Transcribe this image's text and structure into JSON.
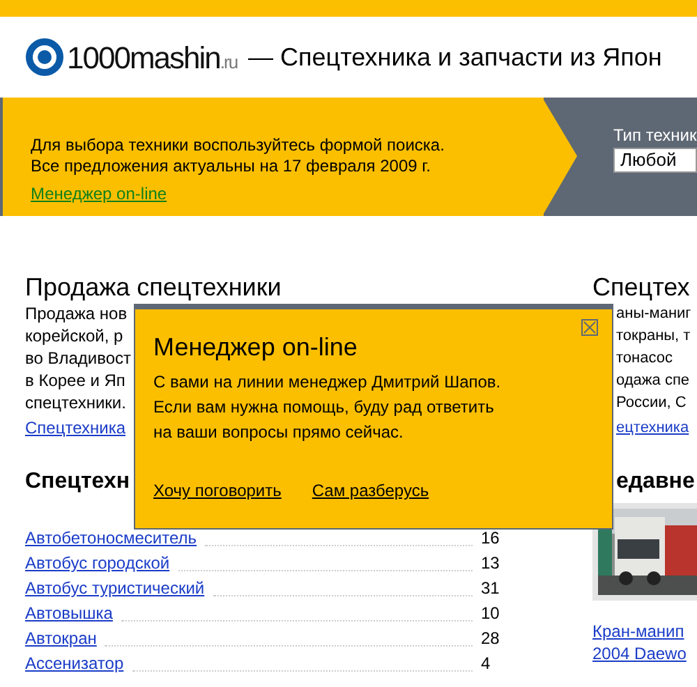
{
  "header": {
    "logo_name": "1000mashin",
    "logo_domain": ".ru",
    "title": "— Спецтехника и запчасти из Япон"
  },
  "banner": {
    "lines": [
      "Для выбора техники воспользуйтесь формой поиска.",
      "Все предложения актуальны на 17 февраля 2009 г."
    ],
    "link": "Менеджер on-line",
    "search_label": "Тип техник",
    "select_value": "Любой"
  },
  "left": {
    "heading": "Продажа спецтехники",
    "paragraph_lines": [
      "Продажа нов",
      "корейской, р",
      "во Владивост",
      "в Корее и Яп",
      "спецтехники."
    ],
    "link": "Спецтехника",
    "list_heading": "Спецтехн",
    "rows": [
      {
        "name": "Автобетоносмеситель",
        "count": "16"
      },
      {
        "name": "Автобус городской",
        "count": "13"
      },
      {
        "name": "Автобус туристический",
        "count": "31"
      },
      {
        "name": "Автовышка",
        "count": "10"
      },
      {
        "name": "Автокран",
        "count": "28"
      },
      {
        "name": "Ассенизатор",
        "count": "4"
      }
    ]
  },
  "right": {
    "heading": "Спецтех",
    "paragraph_lines": [
      "аны-маниг",
      "токраны, т",
      "тонасос",
      "одажа спе",
      "России, С"
    ],
    "link": "ецтехника",
    "recent_heading": "едавне",
    "recent_links": [
      "Кран-манип",
      "2004 Daewo"
    ]
  },
  "popup": {
    "title": "Менеджер on-line",
    "lines": [
      "С вами на линии менеджер Дмитрий Шапов.",
      "Если вам нужна помощь, буду рад ответить",
      "на ваши вопросы прямо сейчас."
    ],
    "actions": [
      "Хочу поговорить",
      "Сам разберусь"
    ]
  }
}
